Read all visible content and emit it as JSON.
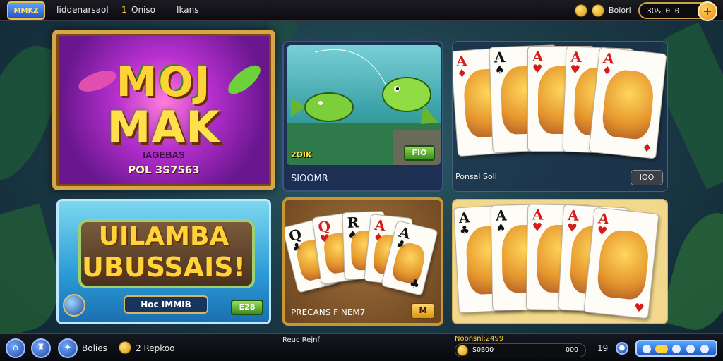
{
  "topbar": {
    "logo_text": "MMKZ",
    "nav": [
      "Iiddenarsaol",
      "Oniso",
      "Ikans"
    ],
    "nav_prefix": "1",
    "user_label": "Bolori",
    "balance": "3O&  0  0",
    "add_symbol": "+"
  },
  "tiles": {
    "mojo": {
      "line1": "MOJ",
      "line2": "MAK",
      "sub": "IAGEBAS",
      "code": "POL 3S7563"
    },
    "fish": {
      "badge_left": "2OIK",
      "badge_right": "FIO",
      "label": "SIOOMR"
    },
    "cards_top": {
      "label": "Ponsal Soll",
      "button": "IOO"
    },
    "wave": {
      "line1": "UILAMBA",
      "line2": "UBUSSAIS!",
      "pill": "Hoc IMMIB",
      "button": "E28"
    },
    "poker": {
      "label": "PRECANS F NEM7",
      "button": "M"
    }
  },
  "cards_top_deck": [
    {
      "rank": "A",
      "suit": "♦",
      "color": "red"
    },
    {
      "rank": "A",
      "suit": "♠",
      "color": "blk"
    },
    {
      "rank": "A",
      "suit": "♥",
      "color": "red"
    },
    {
      "rank": "A",
      "suit": "♥",
      "color": "red"
    },
    {
      "rank": "A",
      "suit": "♦",
      "color": "red"
    }
  ],
  "cards_bottom_deck": [
    {
      "rank": "A",
      "suit": "♣",
      "color": "blk"
    },
    {
      "rank": "A",
      "suit": "♠",
      "color": "blk"
    },
    {
      "rank": "A",
      "suit": "♥",
      "color": "red"
    },
    {
      "rank": "A",
      "suit": "♥",
      "color": "red"
    },
    {
      "rank": "A",
      "suit": "♥",
      "color": "red"
    }
  ],
  "poker_deck": [
    {
      "rank": "Q",
      "suit": "♣",
      "color": "blk"
    },
    {
      "rank": "Q",
      "suit": "♥",
      "color": "red"
    },
    {
      "rank": "R",
      "suit": "♠",
      "color": "blk"
    },
    {
      "rank": "A",
      "suit": "♦",
      "color": "red"
    },
    {
      "rank": "A",
      "suit": "♣",
      "color": "blk"
    }
  ],
  "bottombar": {
    "left_label": "Bolies",
    "mid_label": "2 Repkoo",
    "center_label": "Reuc Rejnf",
    "wallet_top": "Noonsnl:2499",
    "wallet_value": "SOBOO",
    "wallet_right": "OOO",
    "counter": "19"
  }
}
